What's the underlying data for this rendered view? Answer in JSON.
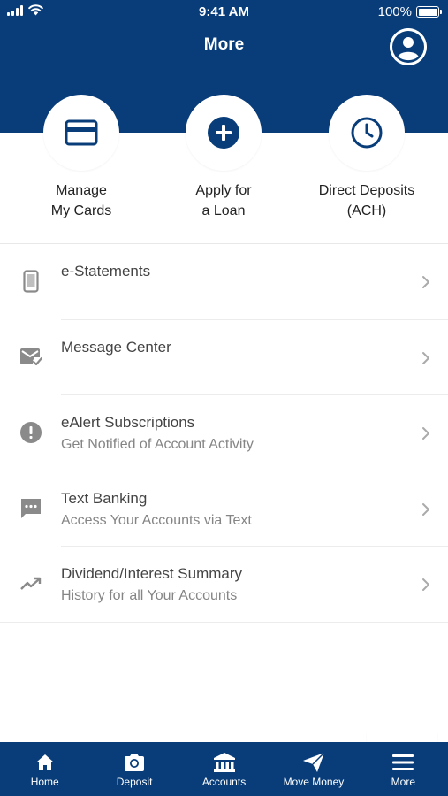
{
  "status_bar": {
    "time": "9:41 AM",
    "battery": "100%"
  },
  "header": {
    "title": "More"
  },
  "quick_actions": [
    {
      "line1": "Manage",
      "line2": "My Cards",
      "icon": "credit-card-icon"
    },
    {
      "line1": "Apply for",
      "line2": "a Loan",
      "icon": "plus-circle-icon"
    },
    {
      "line1": "Direct Deposits",
      "line2": "(ACH)",
      "icon": "clock-icon"
    }
  ],
  "menu": [
    {
      "title": "e-Statements",
      "subtitle": "",
      "icon": "mobile-document-icon"
    },
    {
      "title": "Message Center",
      "subtitle": "",
      "icon": "mail-check-icon"
    },
    {
      "title": "eAlert Subscriptions",
      "subtitle": "Get Notified of Account Activity",
      "icon": "alert-icon"
    },
    {
      "title": "Text Banking",
      "subtitle": "Access Your Accounts via Text",
      "icon": "chat-icon"
    },
    {
      "title": "Dividend/Interest Summary",
      "subtitle": "History for all Your Accounts",
      "icon": "trending-up-icon"
    }
  ],
  "tabs": [
    {
      "label": "Home",
      "icon": "home-icon"
    },
    {
      "label": "Deposit",
      "icon": "camera-icon"
    },
    {
      "label": "Accounts",
      "icon": "bank-icon"
    },
    {
      "label": "Move Money",
      "icon": "send-icon"
    },
    {
      "label": "More",
      "icon": "menu-icon"
    }
  ],
  "colors": {
    "brand": "#083d7a",
    "icon_gray": "#8a8a8a"
  }
}
